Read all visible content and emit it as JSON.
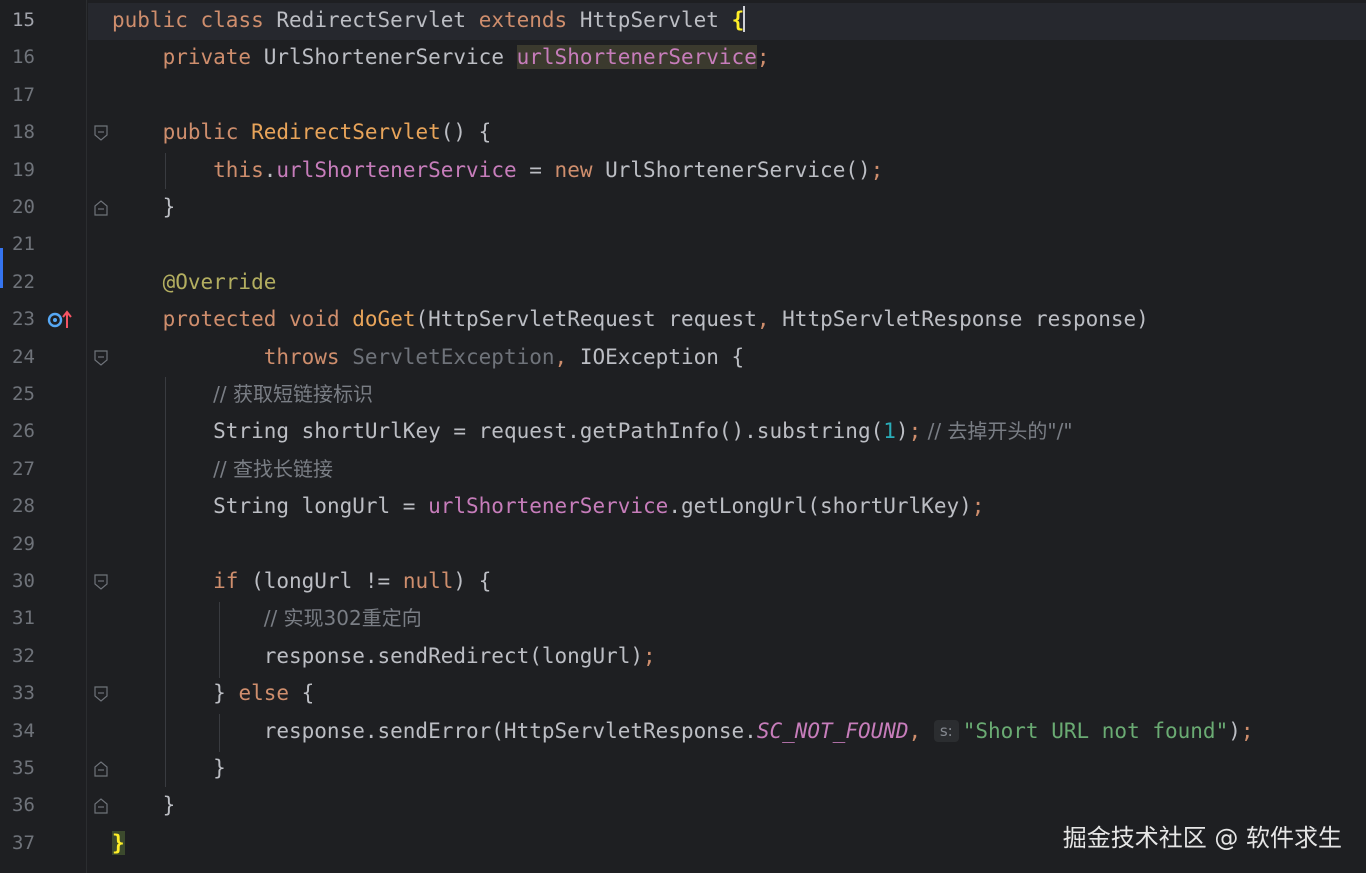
{
  "editor": {
    "lines": [
      {
        "n": "15",
        "active": true
      },
      {
        "n": "16"
      },
      {
        "n": "17"
      },
      {
        "n": "18"
      },
      {
        "n": "19"
      },
      {
        "n": "20"
      },
      {
        "n": "21"
      },
      {
        "n": "22"
      },
      {
        "n": "23"
      },
      {
        "n": "24"
      },
      {
        "n": "25"
      },
      {
        "n": "26"
      },
      {
        "n": "27"
      },
      {
        "n": "28"
      },
      {
        "n": "29"
      },
      {
        "n": "30"
      },
      {
        "n": "31"
      },
      {
        "n": "32"
      },
      {
        "n": "33"
      },
      {
        "n": "34"
      },
      {
        "n": "35"
      },
      {
        "n": "36"
      },
      {
        "n": "37"
      }
    ],
    "code": {
      "l15": {
        "k1": "public",
        "k2": "class",
        "name": "RedirectServlet",
        "k3": "extends",
        "sup": "HttpServlet",
        "brace": "{"
      },
      "l16": {
        "k1": "private",
        "type": "UrlShortenerService",
        "field": "urlShortenerService",
        "semi": ";"
      },
      "l18": {
        "k1": "public",
        "ctor": "RedirectServlet",
        "rest": "() {"
      },
      "l19": {
        "k1": "this",
        "dot": ".",
        "field": "urlShortenerService",
        "eq": " = ",
        "k2": "new",
        "rest": " UrlShortenerService()",
        "semi": ";"
      },
      "l20": {
        "rest": "}"
      },
      "l22": {
        "ann": "@Override"
      },
      "l23": {
        "k1": "protected",
        "k2": "void",
        "method": "doGet",
        "rest": "(HttpServletRequest request",
        "comma": ",",
        "rest2": " HttpServletResponse response)"
      },
      "l24": {
        "k1": "throws",
        "dim": " ServletException",
        "comma": ",",
        "rest": " IOException {"
      },
      "l25": {
        "com": "// 获取短链接标识"
      },
      "l26": {
        "pre": "String shortUrlKey = request.getPathInfo().substring(",
        "num": "1",
        "post": ")",
        "semi": ";",
        "com": " // 去掉开头的\"/\""
      },
      "l27": {
        "com": "// 查找长链接"
      },
      "l28": {
        "pre": "String longUrl = ",
        "field": "urlShortenerService",
        "post": ".getLongUrl(shortUrlKey)",
        "semi": ";"
      },
      "l30": {
        "k1": "if",
        "pre": " (longUrl != ",
        "k2": "null",
        "post": ") {"
      },
      "l31": {
        "com": "// 实现302重定向"
      },
      "l32": {
        "pre": "response.sendRedirect(longUrl)",
        "semi": ";"
      },
      "l33": {
        "pre": "} ",
        "k1": "else",
        "post": " {"
      },
      "l34": {
        "pre": "response.sendError(HttpServletResponse.",
        "static": "SC_NOT_FOUND",
        "comma": ",",
        "hint": "s:",
        "str": "\"Short URL not found\"",
        "post": ")",
        "semi": ";"
      },
      "l35": {
        "rest": "}"
      },
      "l36": {
        "rest": "}"
      },
      "l37": {
        "brace": "}"
      }
    }
  },
  "watermark": "掘金技术社区 @ 软件求生",
  "icons": {
    "fold": "fold-marker-icon",
    "override": "override-method-icon"
  }
}
